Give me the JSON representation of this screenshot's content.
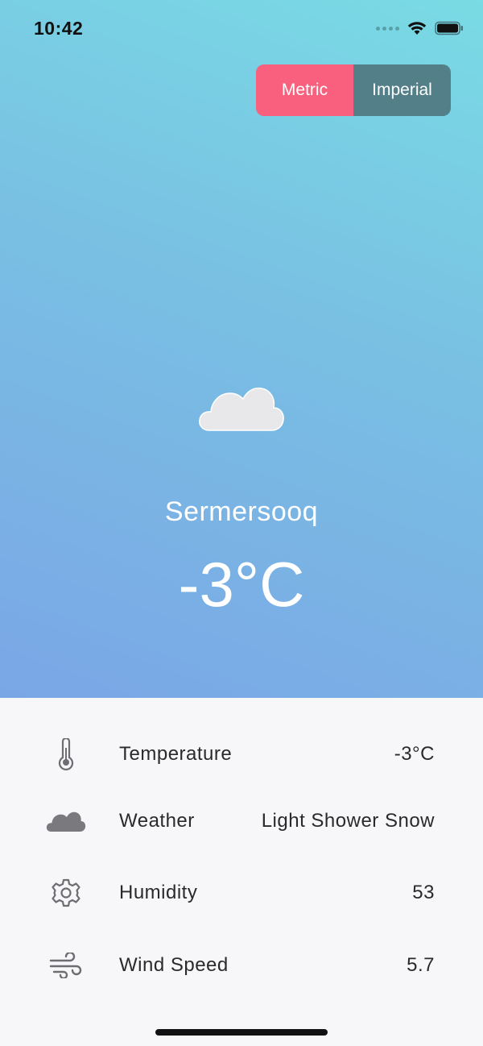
{
  "status_bar": {
    "time": "10:42"
  },
  "unit_toggle": {
    "options": [
      {
        "label": "Metric",
        "selected": true
      },
      {
        "label": "Imperial",
        "selected": false
      }
    ],
    "active_color": "#f8607e",
    "inactive_color": "#537f89"
  },
  "current": {
    "icon": "cloud-icon",
    "city": "Sermersooq",
    "temperature": "-3°C"
  },
  "details": [
    {
      "icon": "thermometer-icon",
      "label": "Temperature",
      "value": "-3°C"
    },
    {
      "icon": "cloud-icon",
      "label": "Weather",
      "value": "Light Shower Snow"
    },
    {
      "icon": "gear-icon",
      "label": "Humidity",
      "value": "53"
    },
    {
      "icon": "wind-icon",
      "label": "Wind Speed",
      "value": "5.7"
    }
  ],
  "colors": {
    "gradient_top": "#79dbe4",
    "gradient_bottom": "#7aa6e6",
    "panel_background": "#f7f6f9"
  }
}
